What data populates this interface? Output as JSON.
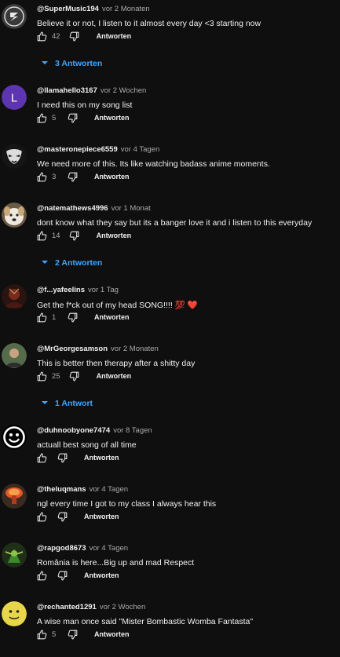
{
  "comments": [
    {
      "author": "@SuperMusic194",
      "time": "vor 2 Monaten",
      "text": "Believe it or not, I listen to it almost every day <3 starting now",
      "likes": "42",
      "reply": "Antworten",
      "replies": "3 Antworten",
      "avatar": "supermusic-logo-avatar"
    },
    {
      "author": "@llamahello3167",
      "time": "vor 2 Wochen",
      "text": "I need this on my song list",
      "likes": "5",
      "reply": "Antworten",
      "avatar": "letter-l-avatar",
      "avatar_letter": "L",
      "avatar_color": "#5e35b1"
    },
    {
      "author": "@masteronepiece6559",
      "time": "vor 4 Tagen",
      "text": "We need more of this. Its like watching badass anime moments.",
      "likes": "3",
      "reply": "Antworten",
      "avatar": "anime-mask-avatar"
    },
    {
      "author": "@natemathews4996",
      "time": "vor 1 Monat",
      "text": "dont know what they say but its a banger love it and i listen to this everyday",
      "likes": "14",
      "reply": "Antworten",
      "replies": "2 Antworten",
      "avatar": "dog-avatar"
    },
    {
      "author": "@f...yafeelins",
      "time": "vor 1 Tag",
      "text": "Get the f*ck out of my head SONG!!!! 💯 ❤️",
      "likes": "1",
      "reply": "Antworten",
      "avatar": "dark-art-avatar"
    },
    {
      "author": "@MrGeorgesamson",
      "time": "vor 2 Monaten",
      "text": "This is better then therapy after a shitty day",
      "likes": "25",
      "reply": "Antworten",
      "replies": "1 Antwort",
      "avatar": "person-photo-avatar"
    },
    {
      "author": "@duhnoobyone7474",
      "time": "vor 8 Tagen",
      "text": "actuall best song of all time",
      "likes": "",
      "reply": "Antworten",
      "avatar": "smiley-face-avatar"
    },
    {
      "author": "@theluqmans",
      "time": "vor 4 Tagen",
      "text": "ngl every time I got to my class I always hear this",
      "likes": "",
      "reply": "Antworten",
      "avatar": "explosion-avatar"
    },
    {
      "author": "@rapgod8673",
      "time": "vor 4 Tagen",
      "text": "România is here...Big up and mad Respect",
      "likes": "",
      "reply": "Antworten",
      "avatar": "green-character-avatar"
    },
    {
      "author": "@rechanted1291",
      "time": "vor 2 Wochen",
      "text": "A wise man once said \"Mister Bombastic Womba Fantasta\"",
      "likes": "5",
      "reply": "Antworten",
      "avatar": "yellow-face-avatar"
    }
  ],
  "colors": {
    "background": "#0f0f0f",
    "text": "#f1f1f1",
    "secondary": "#aaaaaa",
    "link": "#3ea6ff"
  },
  "icons": {
    "like": "thumbs-up-icon",
    "dislike": "thumbs-down-icon",
    "expand": "chevron-down-icon"
  }
}
